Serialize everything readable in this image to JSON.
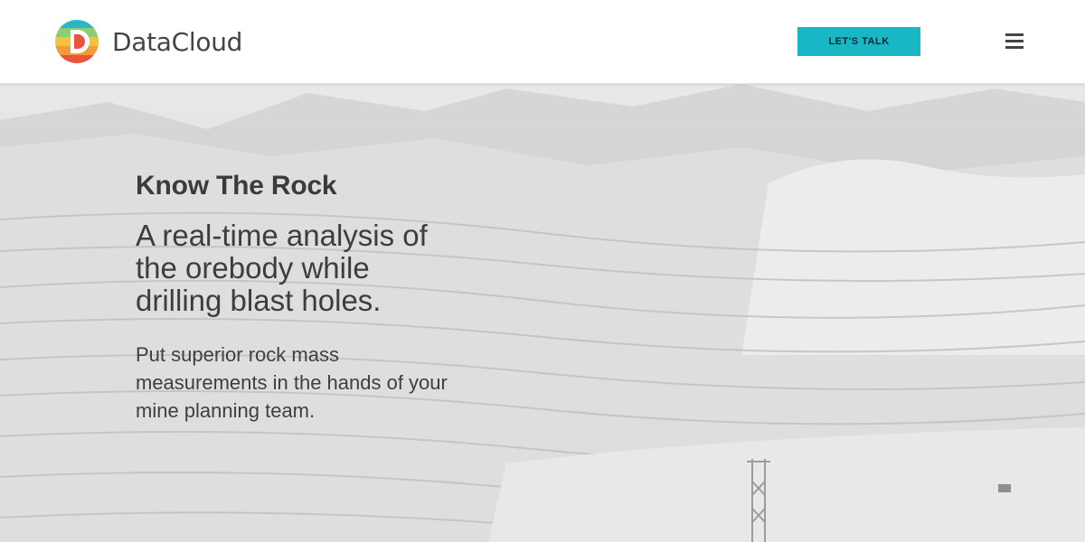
{
  "header": {
    "brand": "DataCloud",
    "cta_label": "LET'S TALK",
    "menu_icon": "hamburger-menu-icon"
  },
  "hero": {
    "kicker": "Know The Rock",
    "headline": "A real-time analysis of the orebody while drilling blast holes.",
    "body": "Put superior rock mass measurements in the hands of your mine planning team."
  },
  "colors": {
    "accent": "#19b6c6",
    "text": "#3a3a3a",
    "logo_orange": "#f0783c",
    "logo_yellow": "#f6c23e",
    "logo_teal": "#2ab7c4"
  }
}
